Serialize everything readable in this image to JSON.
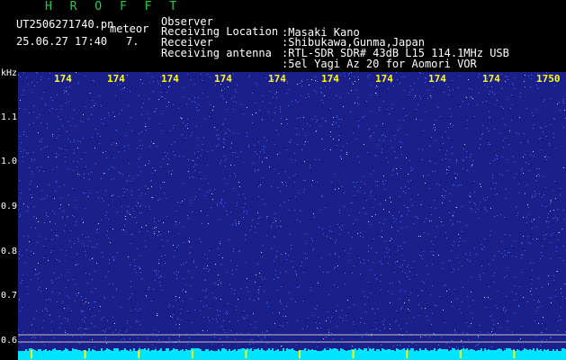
{
  "header": {
    "brand": "H R O F F T",
    "file_name": "UT2506271740.pn",
    "date_time": "25.06.27 17:40",
    "meteor_label": "meteor",
    "meteor_count": "7.",
    "rows": [
      {
        "label": "Observer",
        "value": ":Masaki Kano"
      },
      {
        "label": "Receiving Location",
        "value": ":Shibukawa,Gunma,Japan"
      },
      {
        "label": "Receiver",
        "value": ":RTL-SDR SDR# 43dB L15 114.1MHz USB"
      },
      {
        "label": "Receiving antenna",
        "value": ":5el Yagi Az 20 for Aomori VOR"
      }
    ]
  },
  "plot": {
    "y_unit": "kHz",
    "y_ticks": [
      "1.1",
      "1.0",
      "0.9",
      "0.8",
      "0.7",
      "0.6"
    ],
    "x_ticks": [
      "174",
      "174",
      "174",
      "174",
      "174",
      "174",
      "174",
      "174",
      "174",
      "1750"
    ],
    "colors": {
      "background": "#1a1f8a",
      "dots": "#4a6cff",
      "bright": "#c8d8ff",
      "floor": "#00e5ff",
      "marker": "#ffff00"
    }
  }
}
